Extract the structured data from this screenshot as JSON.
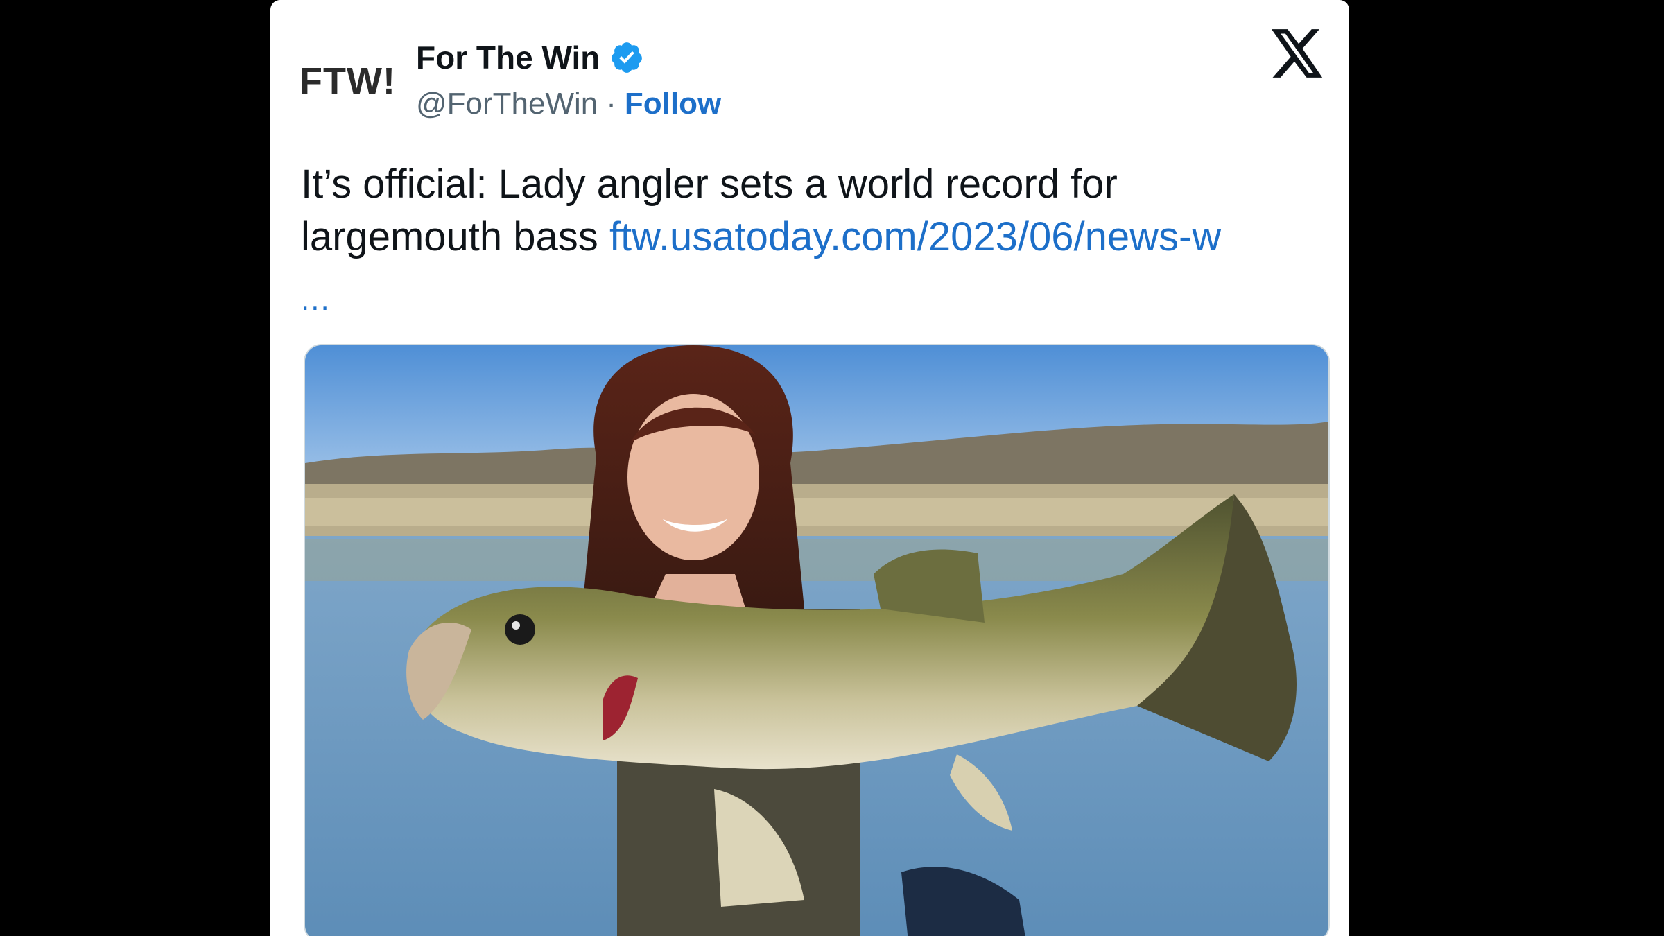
{
  "tweet": {
    "author": {
      "display_name": "For The Win",
      "handle": "@ForTheWin",
      "avatar_text": "FTW!",
      "verified": true
    },
    "separator": "·",
    "follow_label": "Follow",
    "text": "It’s official: Lady angler sets a world record for largemouth bass",
    "link_text": "ftw.usatoday.com/2023/06/news-w",
    "ellipsis": "...",
    "platform_icon": "x-logo-icon"
  },
  "colors": {
    "background": "#000000",
    "card": "#ffffff",
    "text_primary": "#0f1419",
    "text_secondary": "#536471",
    "link": "#1d6fc9",
    "verified_badge": "#1d9bf0",
    "logo_dot": "#e0262b"
  }
}
